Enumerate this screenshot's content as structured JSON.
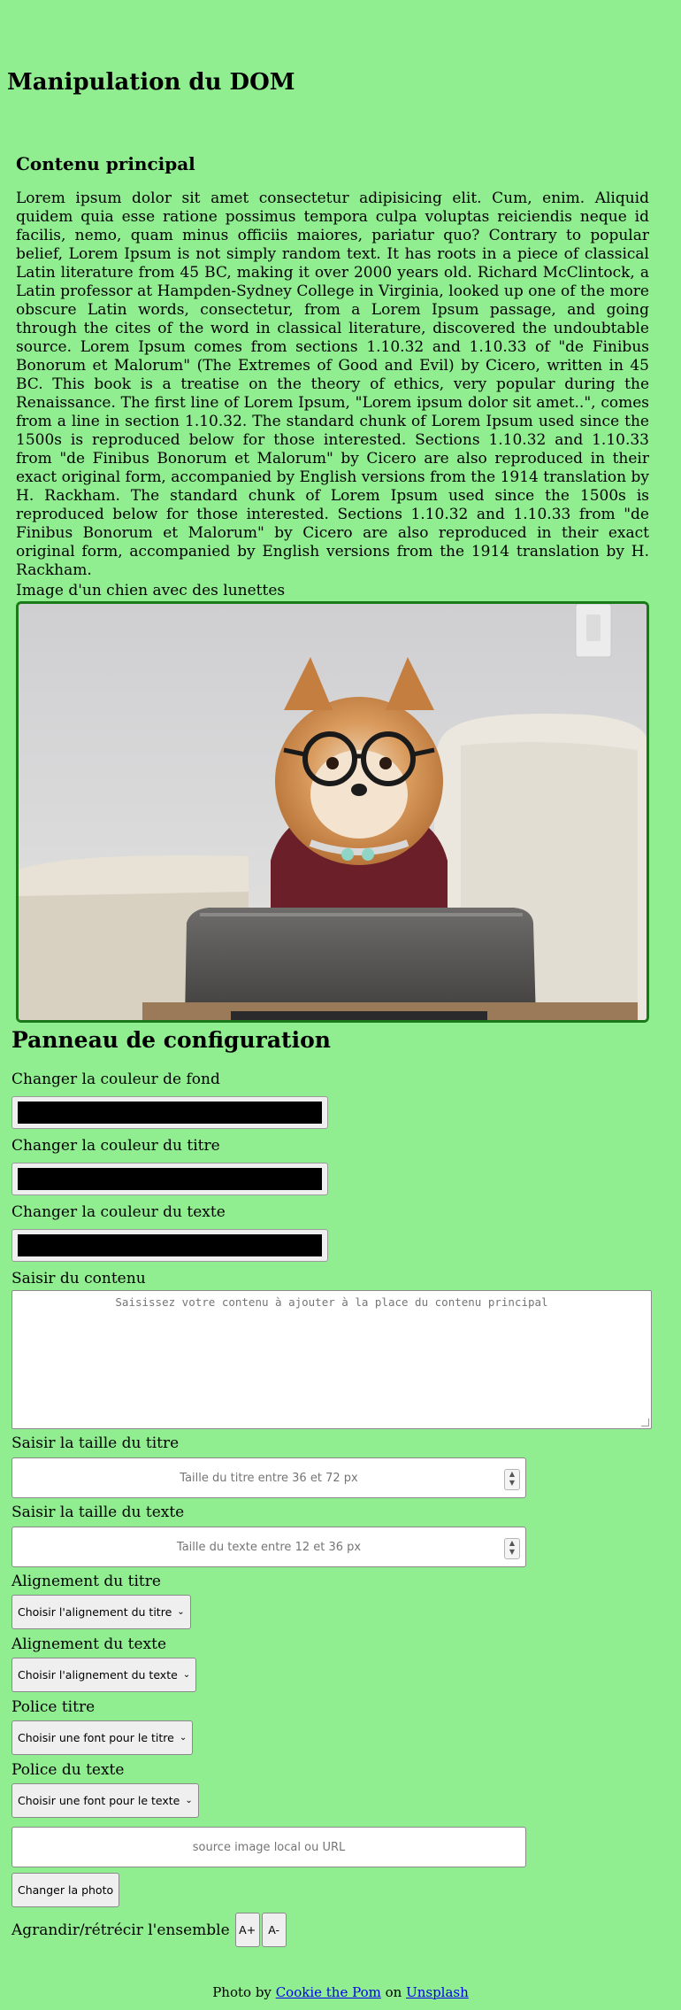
{
  "page": {
    "title": "Manipulation du DOM"
  },
  "main": {
    "heading": "Contenu principal",
    "paragraph": "Lorem ipsum dolor sit amet consectetur adipisicing elit. Cum, enim. Aliquid quidem quia esse ratione possimus tempora culpa voluptas reiciendis neque id facilis, nemo, quam minus officiis maiores, pariatur quo? Contrary to popular belief, Lorem Ipsum is not simply random text. It has roots in a piece of classical Latin literature from 45 BC, making it over 2000 years old. Richard McClintock, a Latin professor at Hampden-Sydney College in Virginia, looked up one of the more obscure Latin words, consectetur, from a Lorem Ipsum passage, and going through the cites of the word in classical literature, discovered the undoubtable source. Lorem Ipsum comes from sections 1.10.32 and 1.10.33 of \"de Finibus Bonorum et Malorum\" (The Extremes of Good and Evil) by Cicero, written in 45 BC. This book is a treatise on the theory of ethics, very popular during the Renaissance. The first line of Lorem Ipsum, \"Lorem ipsum dolor sit amet..\", comes from a line in section 1.10.32. The standard chunk of Lorem Ipsum used since the 1500s is reproduced below for those interested. Sections 1.10.32 and 1.10.33 from \"de Finibus Bonorum et Malorum\" by Cicero are also reproduced in their exact original form, accompanied by English versions from the 1914 translation by H. Rackham. The standard chunk of Lorem Ipsum used since the 1500s is reproduced below for those interested. Sections 1.10.32 and 1.10.33 from \"de Finibus Bonorum et Malorum\" by Cicero are also reproduced in their exact original form, accompanied by English versions from the 1914 translation by H. Rackham.",
    "image_caption": "Image d'un chien avec des lunettes"
  },
  "config": {
    "heading": "Panneau de configuration",
    "bg_color_label": "Changer la couleur de fond",
    "bg_color_value": "#000000",
    "title_color_label": "Changer la couleur du titre",
    "title_color_value": "#000000",
    "text_color_label": "Changer la couleur du texte",
    "text_color_value": "#000000",
    "content_label": "Saisir du contenu",
    "content_placeholder": "Saisissez votre contenu à ajouter à la place du contenu principal",
    "title_size_label": "Saisir la taille du titre",
    "title_size_placeholder": "Taille du titre entre 36 et 72 px",
    "text_size_label": "Saisir la taille du texte",
    "text_size_placeholder": "Taille du texte entre 12 et 36 px",
    "title_align_label": "Alignement du titre",
    "title_align_selected": "Choisir l'alignement du titre",
    "text_align_label": "Alignement du texte",
    "text_align_selected": "Choisir l'alignement du texte",
    "title_font_label": "Police titre",
    "title_font_selected": "Choisir une font pour le titre",
    "text_font_label": "Police du texte",
    "text_font_selected": "Choisir une font pour le texte",
    "image_src_placeholder": "source image local ou URL",
    "change_photo_label": "Changer la photo",
    "zoom_label": "Agrandir/rétrécir l'ensemble",
    "zoom_in_label": "A+",
    "zoom_out_label": "A-"
  },
  "footer": {
    "prefix": "Photo by ",
    "author": "Cookie the Pom",
    "middle": " on ",
    "site": "Unsplash"
  },
  "colors": {
    "page_background": "#90ee90",
    "image_border": "#1a7a1a",
    "link": "#0000ee"
  }
}
